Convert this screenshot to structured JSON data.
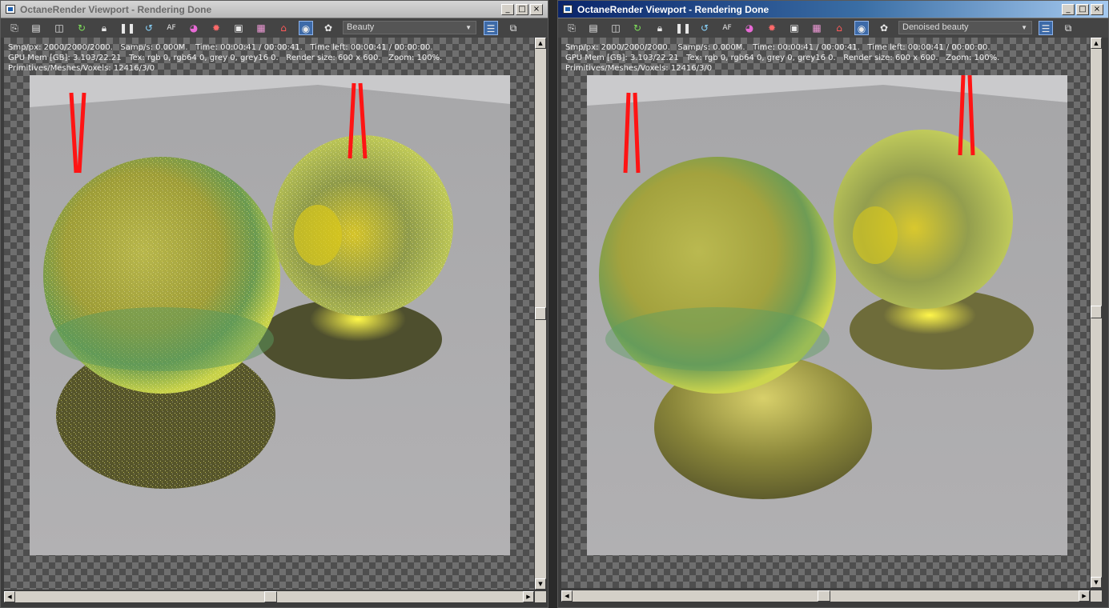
{
  "windows": [
    {
      "title": "OctaneRender Viewport - Rendering Done",
      "state": "inactive",
      "render_pass": "Beauty",
      "stats": {
        "line1": "Smp/px: 2000/2000/2000.   Samp/s: 0.000M.   Time: 00:00:41 / 00:00:41.   Time left: 00:00:41 / 00:00:00.",
        "line2": "GPU Mem [GB]: 3.103/22.21   Tex: rgb 0, rgb64 0, grey 0, grey16 0.   Render size: 600 x 600.   Zoom: 100%.",
        "line3": "Primitives/Meshes/Voxels: 12416/3/0"
      },
      "render_style": "noisy"
    },
    {
      "title": "OctaneRender Viewport - Rendering Done",
      "state": "active",
      "render_pass": "Denoised beauty",
      "stats": {
        "line1": "Smp/px: 2000/2000/2000.   Samp/s: 0.000M.   Time: 00:00:41 / 00:00:41.   Time left: 00:00:41 / 00:00:00.",
        "line2": "GPU Mem [GB]: 3.103/22.21   Tex: rgb 0, rgb64 0, grey 0, grey16 0.   Render size: 600 x 600.   Zoom: 100%.",
        "line3": "Primitives/Meshes/Voxels: 12416/3/0"
      },
      "render_style": "denoised"
    }
  ],
  "window_buttons": {
    "minimize": "_",
    "maximize": "□",
    "close": "×"
  },
  "toolbar_icons": [
    "send-scene-icon",
    "load-scene-icon",
    "region-render-icon",
    "restart-render-icon",
    "lock-viewport-icon",
    "pause-render-icon",
    "reset-camera-icon",
    "autofocus-icon",
    "color-picker-icon",
    "material-picker-icon",
    "save-image-icon",
    "render-pass-icon",
    "settings-icon",
    "camera-view-icon",
    "flower-icon"
  ],
  "right_toolbar_icons": [
    "list-view-icon",
    "fit-window-icon"
  ],
  "colors": {
    "chrome_dark": "#3c3c3c",
    "toolbar": "#444444",
    "active_title": "#0a246a",
    "annotation_arrow": "#ff1414",
    "sphere_glass": "#c8cc3a"
  }
}
